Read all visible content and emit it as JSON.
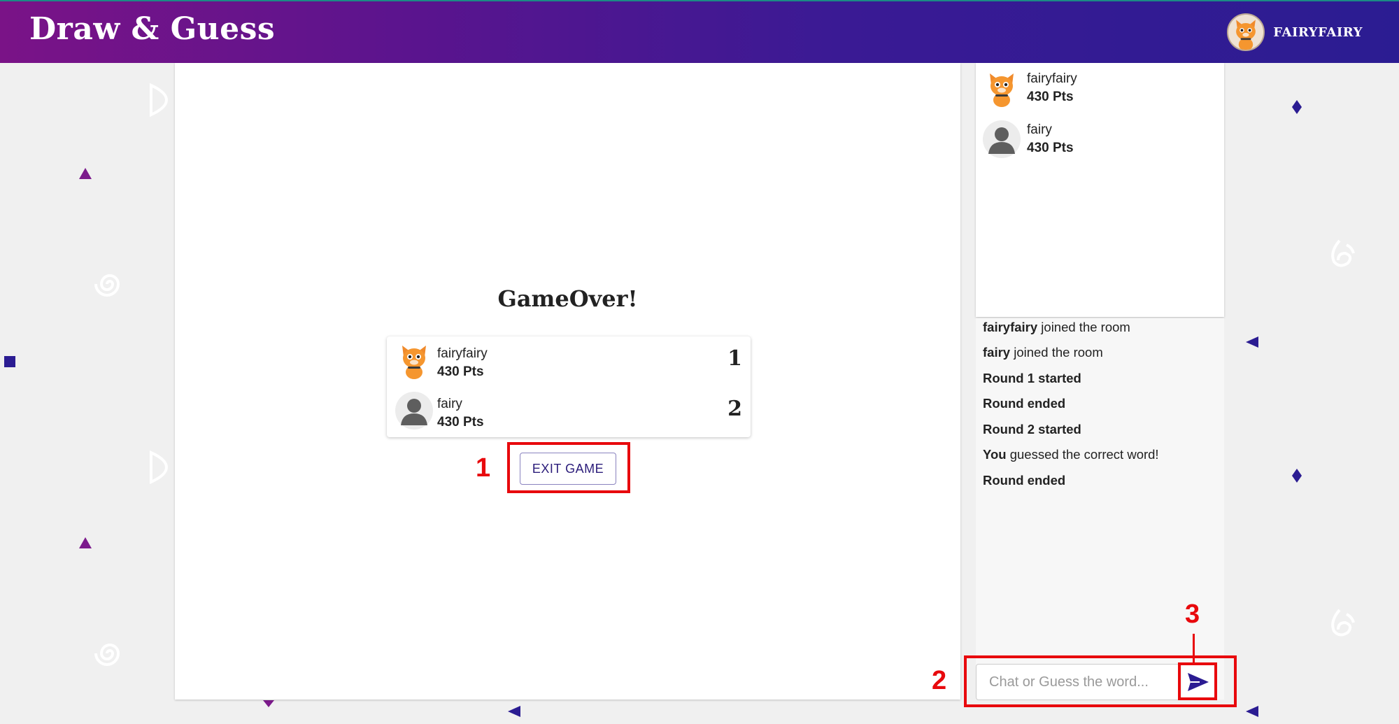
{
  "header": {
    "title": "Draw & Guess",
    "username": "FAIRYFAIRY"
  },
  "game_over": {
    "title": "GameOver!",
    "results": [
      {
        "name": "fairyfairy",
        "points": "430 Pts",
        "rank": "1",
        "avatar": "cat-avatar-icon"
      },
      {
        "name": "fairy",
        "points": "430 Pts",
        "rank": "2",
        "avatar": "default-user-icon"
      }
    ],
    "exit_label": "EXIT GAME"
  },
  "players": [
    {
      "name": "fairyfairy",
      "points": "430 Pts",
      "avatar": "cat-avatar-icon"
    },
    {
      "name": "fairy",
      "points": "430 Pts",
      "avatar": "default-user-icon"
    }
  ],
  "chat": {
    "messages": [
      {
        "bold": "fairyfairy",
        "text": " joined the room"
      },
      {
        "bold": "fairy",
        "text": " joined the room"
      },
      {
        "bold": "Round 1 started",
        "text": ""
      },
      {
        "bold": "Round ended",
        "text": ""
      },
      {
        "bold": "Round 2 started",
        "text": ""
      },
      {
        "bold": "You",
        "text": " guessed the correct word!"
      },
      {
        "bold": "Round ended",
        "text": ""
      }
    ],
    "placeholder": "Chat or Guess the word...",
    "send_icon": "send-icon"
  },
  "annotations": [
    "1",
    "2",
    "3"
  ],
  "colors": {
    "header_start": "#7a1387",
    "header_end": "#2b1c92",
    "accent": "#2b1c7a",
    "annotation": "#e8090d",
    "background": "#f0f0f0"
  }
}
